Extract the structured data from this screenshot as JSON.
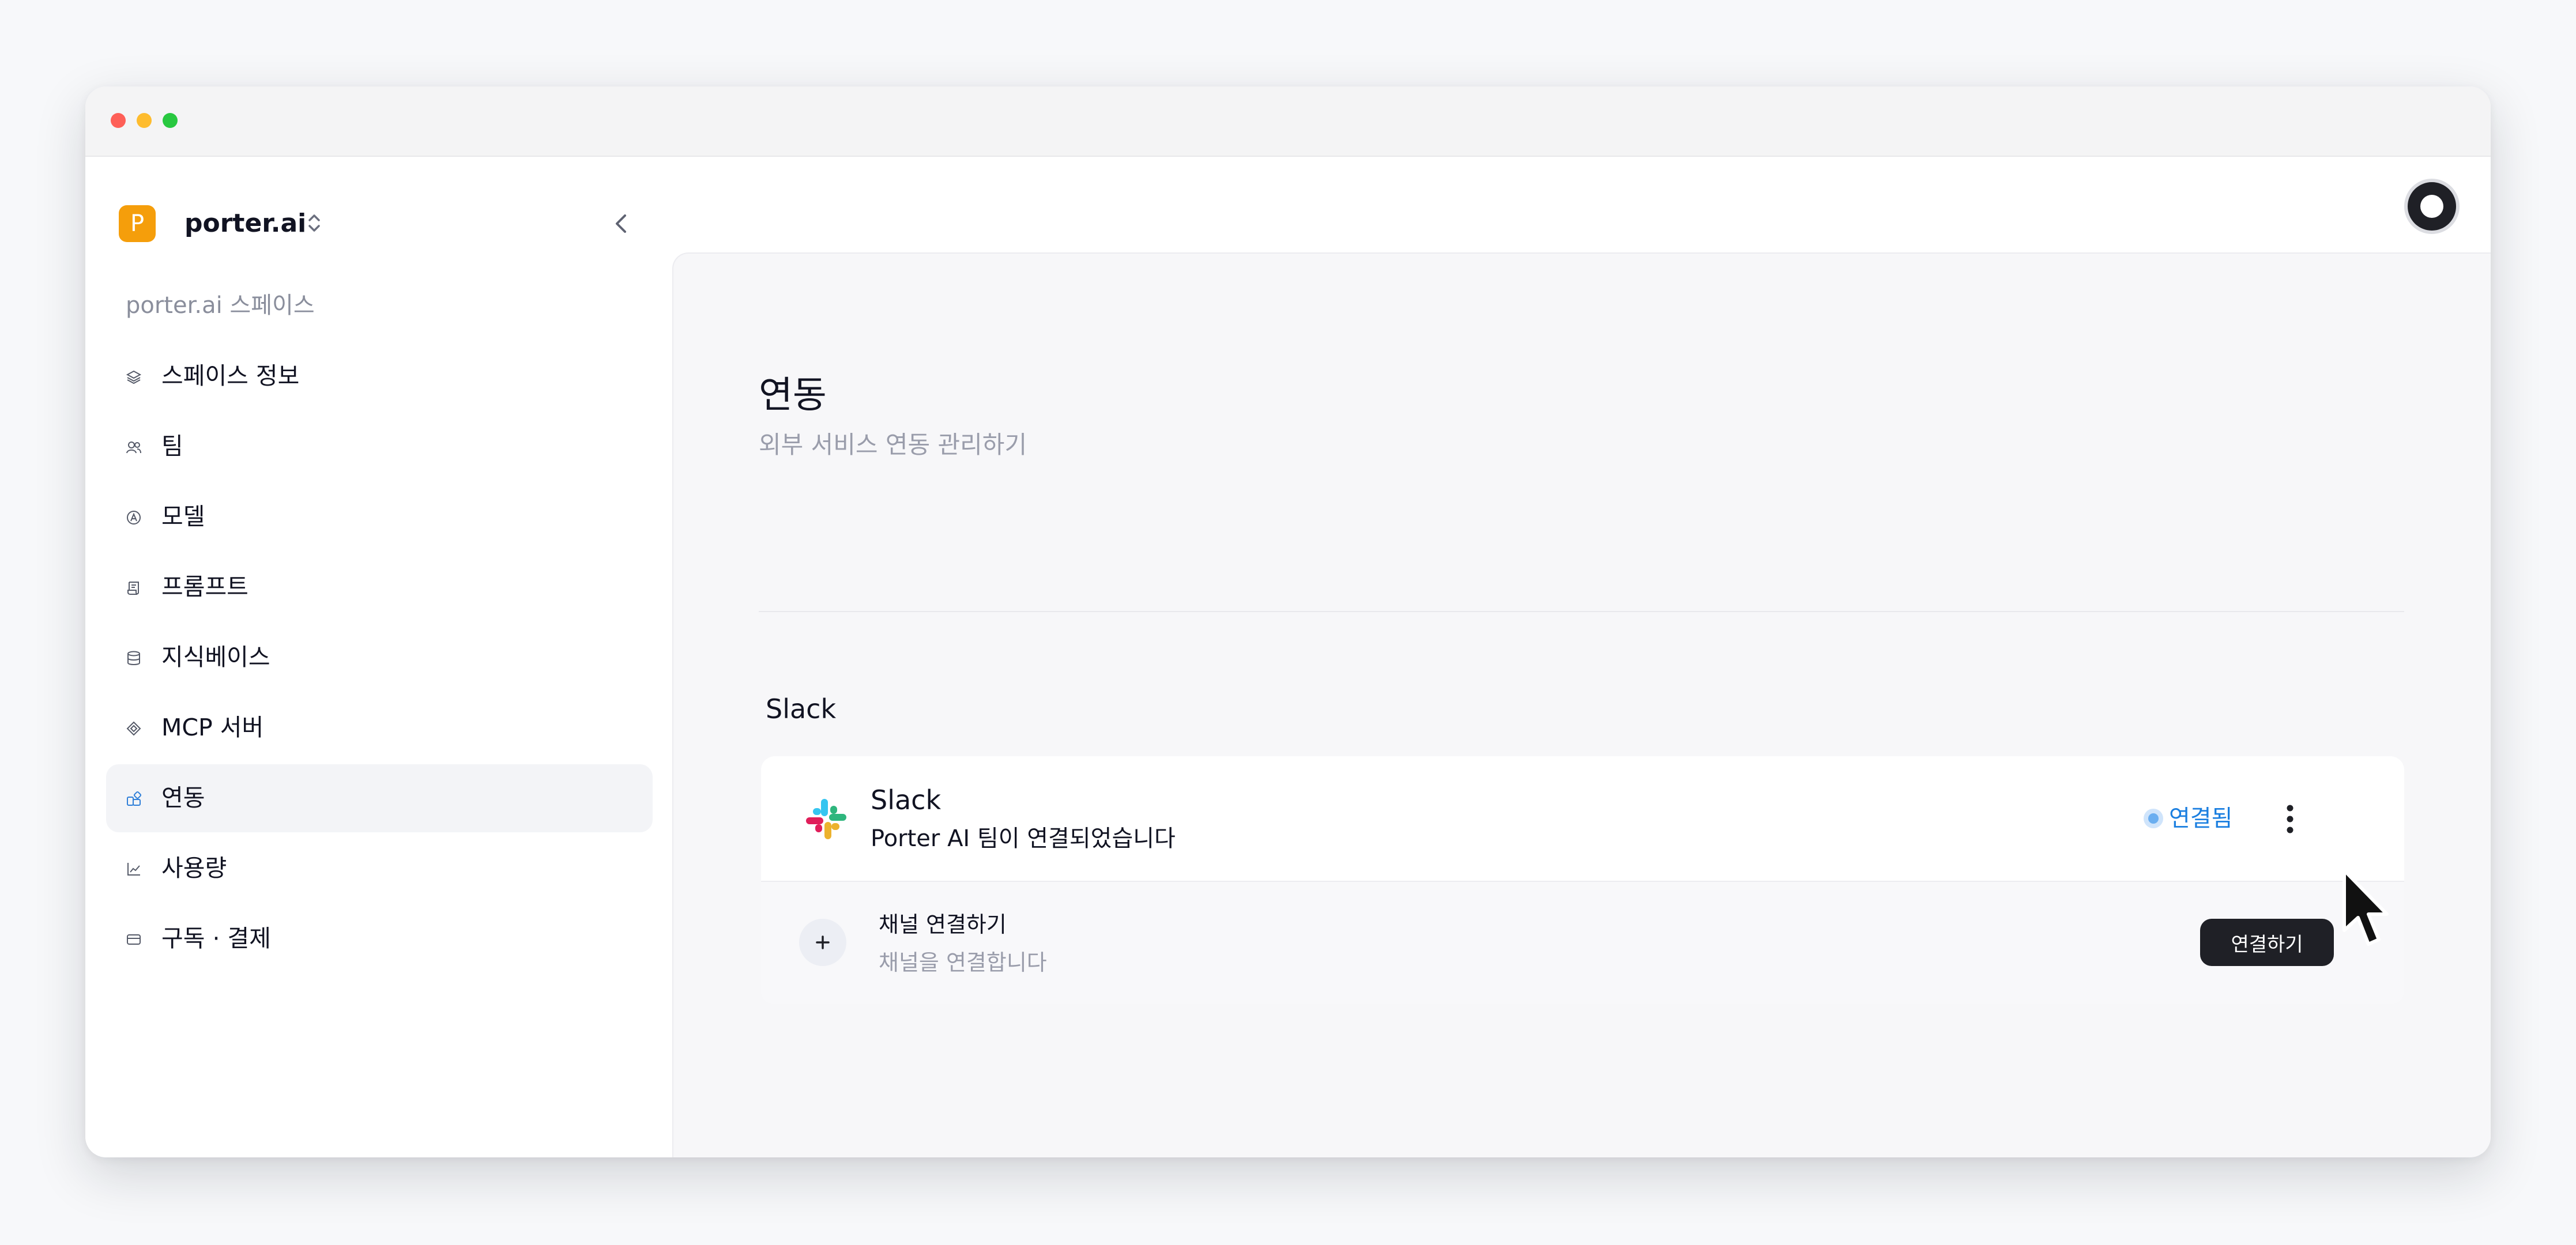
{
  "window": {
    "controls": [
      "close",
      "minimize",
      "zoom"
    ]
  },
  "sidebar": {
    "workspace_initial": "P",
    "workspace_name": "porter.ai",
    "section_label": "porter.ai 스페이스",
    "items": [
      {
        "label": "스페이스 정보",
        "icon": "layers-icon",
        "active": false
      },
      {
        "label": "팀",
        "icon": "users-icon",
        "active": false
      },
      {
        "label": "모델",
        "icon": "model-icon",
        "active": false
      },
      {
        "label": "프롬프트",
        "icon": "scroll-icon",
        "active": false
      },
      {
        "label": "지식베이스",
        "icon": "database-icon",
        "active": false
      },
      {
        "label": "MCP 서버",
        "icon": "mcp-icon",
        "active": false
      },
      {
        "label": "연동",
        "icon": "integrations-icon",
        "active": true
      },
      {
        "label": "사용량",
        "icon": "chart-icon",
        "active": false
      },
      {
        "label": "구독 · 결제",
        "icon": "credit-card-icon",
        "active": false
      }
    ]
  },
  "main": {
    "title": "연동",
    "subtitle": "외부 서비스 연동 관리하기",
    "section_title": "Slack",
    "integration": {
      "name": "Slack",
      "description": "Porter AI 팀이 연결되었습니다",
      "status": "연결됨",
      "status_color": "#1b7fe0"
    },
    "channel": {
      "title": "채널 연결하기",
      "description": "채널을 연결합니다",
      "button_label": "연결하기"
    }
  },
  "colors": {
    "accent_logo": "#f59e0b",
    "primary_button": "#1f2026"
  }
}
